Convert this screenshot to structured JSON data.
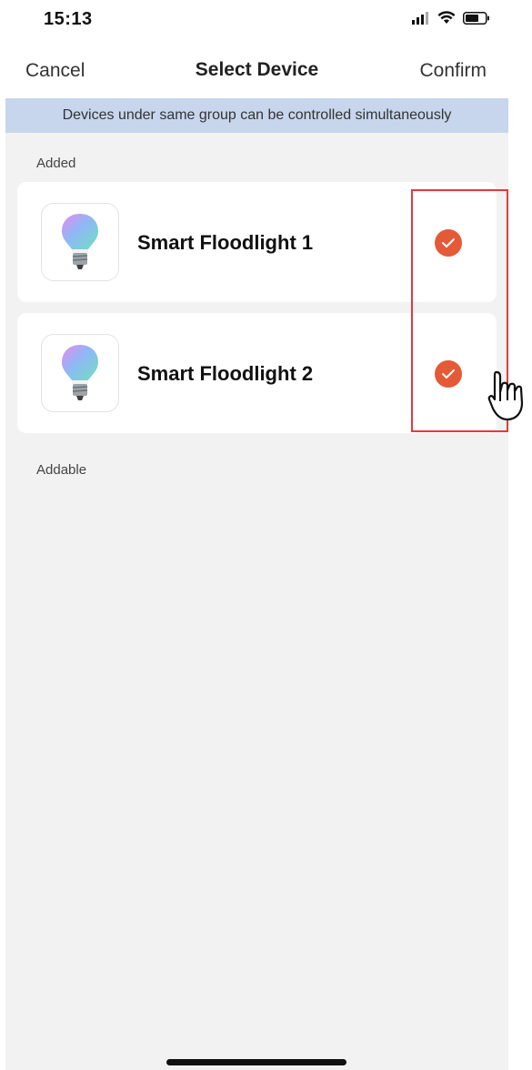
{
  "status_bar": {
    "time": "15:13",
    "icons": [
      "cellular-signal-icon",
      "wifi-icon",
      "battery-icon"
    ]
  },
  "nav": {
    "cancel_label": "Cancel",
    "title": "Select Device",
    "confirm_label": "Confirm"
  },
  "banner": {
    "text": "Devices under same group can be controlled simultaneously"
  },
  "sections": {
    "added_label": "Added",
    "addable_label": "Addable"
  },
  "devices": [
    {
      "name": "Smart Floodlight 1",
      "selected": true,
      "icon": "smart-bulb-icon"
    },
    {
      "name": "Smart Floodlight 2",
      "selected": true,
      "icon": "smart-bulb-icon"
    }
  ],
  "colors": {
    "accent": "#e45a37",
    "banner_bg": "#c7d6ec",
    "highlight": "#e23a3a",
    "content_bg": "#f2f2f2"
  }
}
